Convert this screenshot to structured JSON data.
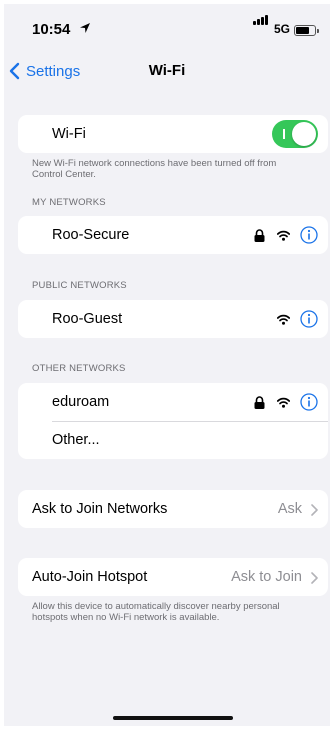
{
  "status_bar": {
    "time": "10:54",
    "network": "5G"
  },
  "nav": {
    "back_label": "Settings",
    "title": "Wi-Fi"
  },
  "wifi_toggle": {
    "label": "Wi-Fi",
    "on": true,
    "accent": "#35c759"
  },
  "wifi_footnote": "New Wi-Fi network connections have been turned off from Control Center.",
  "my_networks": {
    "header": "MY NETWORKS",
    "items": [
      {
        "name": "Roo-Secure",
        "secured": true
      }
    ]
  },
  "public_networks": {
    "header": "PUBLIC NETWORKS",
    "items": [
      {
        "name": "Roo-Guest",
        "secured": false
      }
    ]
  },
  "other_networks": {
    "header": "OTHER NETWORKS",
    "items": [
      {
        "name": "eduroam",
        "secured": true
      }
    ],
    "other_label": "Other..."
  },
  "ask_to_join": {
    "label": "Ask to Join Networks",
    "value": "Ask"
  },
  "auto_join_hotspot": {
    "label": "Auto-Join Hotspot",
    "value": "Ask to Join",
    "footnote": "Allow this device to automatically discover nearby personal hotspots when no Wi-Fi network is available."
  },
  "colors": {
    "link": "#1a73e8",
    "secondary_text": "#6d6d72",
    "background": "#f2f2f6"
  }
}
